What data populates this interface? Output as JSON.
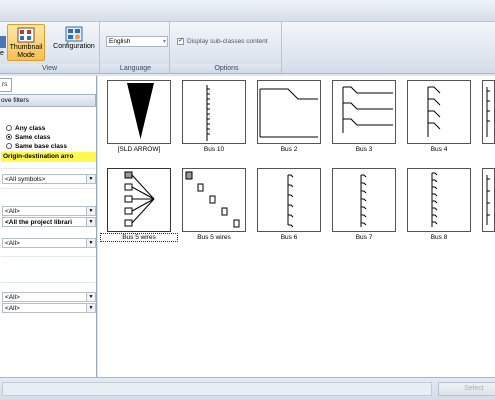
{
  "ribbon": {
    "view_group": {
      "label": "View",
      "partial_button_label": "e",
      "thumbnail_mode_label_line1": "Thumbnail",
      "thumbnail_mode_label_line2": "Mode",
      "configuration_label": "Configuration"
    },
    "language_group": {
      "label": "Language",
      "value": "English"
    },
    "options_group": {
      "label": "Options",
      "display_subclasses_label": "Display sub-classes content",
      "display_subclasses_checked": true
    }
  },
  "left_panel": {
    "tab_label": "rs",
    "remove_filters_label": "ove filters",
    "class_options": [
      {
        "label": "Any class",
        "selected": false
      },
      {
        "label": "Same class",
        "selected": true
      },
      {
        "label": "Same base class",
        "selected": false
      }
    ],
    "highlight_label": "Origin-destination arro",
    "combos": [
      {
        "value": "<All symbols>",
        "bold": false
      },
      {
        "value": "<All>",
        "bold": false
      },
      {
        "value": "<All the project librari",
        "bold": true
      },
      {
        "value": "<All>",
        "bold": false
      },
      {
        "value": "<All>",
        "bold": false
      },
      {
        "value": "<All>",
        "bold": false
      }
    ]
  },
  "symbols": [
    {
      "caption": "[SLD ARROW]",
      "icon": "sld-arrow"
    },
    {
      "caption": "Bus 10",
      "icon": "bus-10"
    },
    {
      "caption": "Bus 2",
      "icon": "bus-2"
    },
    {
      "caption": "Bus 3",
      "icon": "bus-3"
    },
    {
      "caption": "Bus 4",
      "icon": "bus-4"
    },
    {
      "caption": "Bus 5 wires",
      "icon": "bus-5-wires-fan"
    },
    {
      "caption": "Bus 5 wires",
      "icon": "bus-5-wires-diagonal"
    },
    {
      "caption": "Bus 6",
      "icon": "bus-6"
    },
    {
      "caption": "Bus 7",
      "icon": "bus-7"
    },
    {
      "caption": "Bus 8",
      "icon": "bus-8"
    }
  ],
  "bottom": {
    "select_label": "Select"
  }
}
